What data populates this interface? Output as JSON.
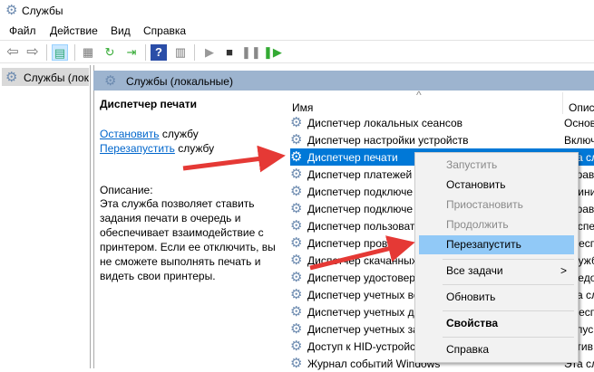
{
  "window": {
    "title": "Службы"
  },
  "menu": [
    "Файл",
    "Действие",
    "Вид",
    "Справка"
  ],
  "tree": {
    "item": "Службы (лок"
  },
  "band": {
    "title": "Службы (локальные)"
  },
  "details": {
    "service": "Диспетчер печати",
    "stop_link": "Остановить",
    "stop_suffix": " службу",
    "restart_link": "Перезапустить",
    "restart_suffix": " службу",
    "desc_label": "Описание:",
    "desc": "Эта служба позволяет ставить задания печати в очередь и обеспечивает взаимодействие с принтером. Если ее отключить, вы не сможете выполнять печать и видеть свои принтеры."
  },
  "columns": {
    "name": "Имя",
    "desc": "Описа"
  },
  "rows": [
    {
      "n": "Диспетчер локальных сеансов",
      "d": "Основ"
    },
    {
      "n": "Диспетчер настройки устройств",
      "d": "Включ"
    },
    {
      "n": "Диспетчер печати",
      "d": "Эта сл"
    },
    {
      "n": "Диспетчер платежей",
      "d": "Управ"
    },
    {
      "n": "Диспетчер подключе",
      "d": "Прини"
    },
    {
      "n": "Диспетчер подключе",
      "d": "Управ"
    },
    {
      "n": "Диспетчер пользоват",
      "d": "Диспе"
    },
    {
      "n": "Диспетчер проверк",
      "d": "Обесп"
    },
    {
      "n": "Диспетчер скачанных",
      "d": "Служб"
    },
    {
      "n": "Диспетчер удостовер",
      "d": "Предо"
    },
    {
      "n": "Диспетчер учетных ве",
      "d": "Эта сл"
    },
    {
      "n": "Диспетчер учетных да",
      "d": "Обесп"
    },
    {
      "n": "Диспетчер учетных за",
      "d": "Запус"
    },
    {
      "n": "Доступ к HID-устройс",
      "d": "Актив"
    },
    {
      "n": "Журнал событий Windows",
      "d": "Эта сл"
    }
  ],
  "context_menu": {
    "start": "Запустить",
    "stop": "Остановить",
    "pause": "Приостановить",
    "resume": "Продолжить",
    "restart": "Перезапустить",
    "all_tasks": "Все задачи",
    "refresh": "Обновить",
    "properties": "Свойства",
    "help": "Справка",
    "submenu_arrow": ">"
  },
  "colors": {
    "selection": "#0078d7",
    "menu_highlight": "#91c9f7",
    "arrow": "#e53935",
    "band": "#9db4cf"
  }
}
